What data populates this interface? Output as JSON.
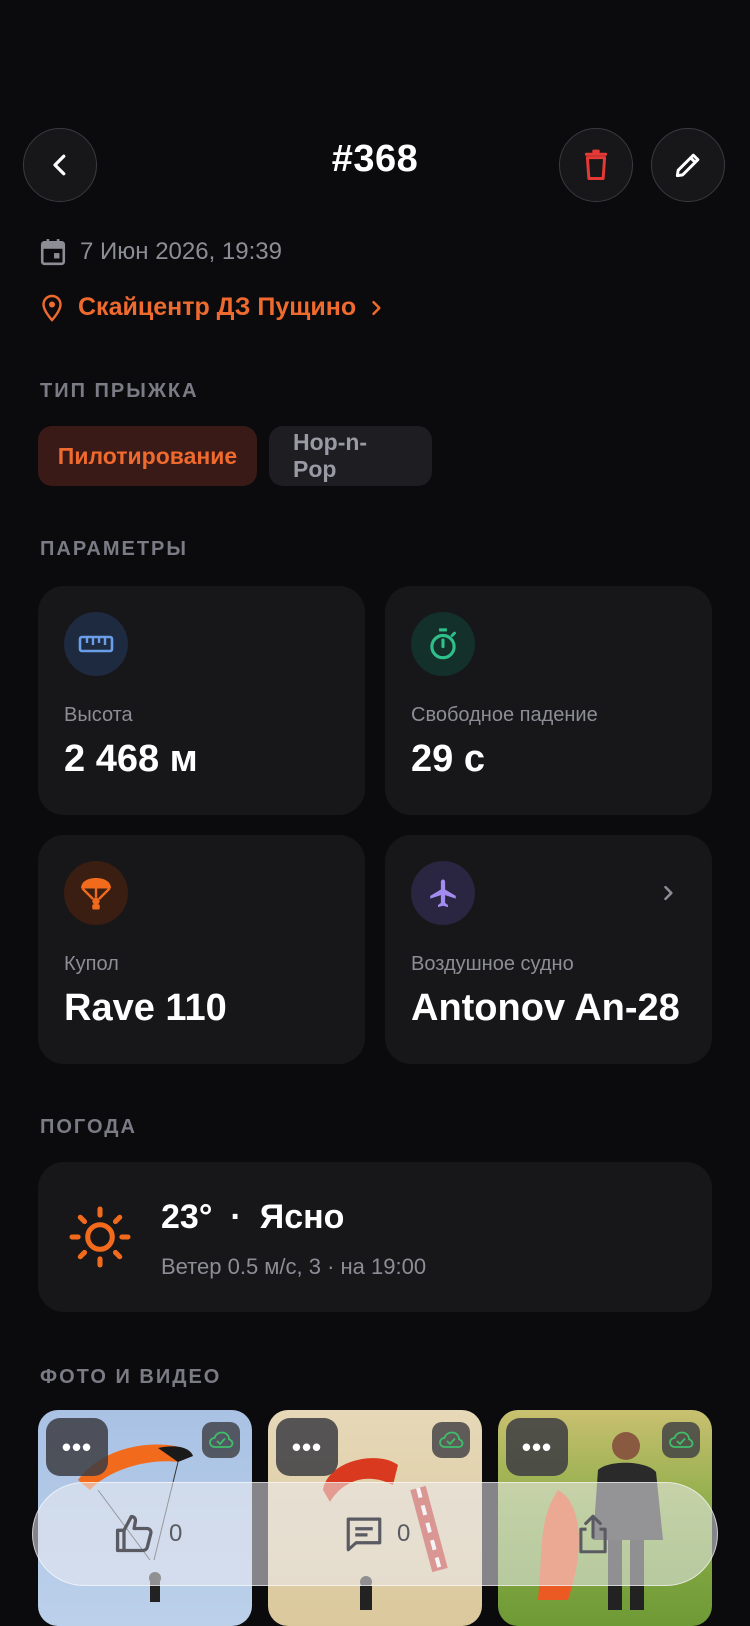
{
  "header": {
    "title": "#368"
  },
  "meta": {
    "date": "7 Июн 2026, 19:39",
    "location": "Скайцентр ДЗ Пущино"
  },
  "jump_type": {
    "label": "ТИП ПРЫЖКА",
    "chips": [
      {
        "label": "Пилотирование",
        "selected": true
      },
      {
        "label": "Hop-n-Pop",
        "selected": false
      }
    ]
  },
  "params": {
    "label": "ПАРАМЕТРЫ",
    "altitude": {
      "label": "Высота",
      "value": "2 468 м",
      "icon": "ruler-icon"
    },
    "freefall": {
      "label": "Свободное падение",
      "value": "29 с",
      "icon": "stopwatch-icon"
    },
    "canopy": {
      "label": "Купол",
      "value": "Rave 110",
      "icon": "parachute-icon"
    },
    "aircraft": {
      "label": "Воздушное судно",
      "value": "Antonov An-28",
      "icon": "airplane-icon"
    }
  },
  "weather": {
    "label": "ПОГОДА",
    "temp": "23°",
    "separator": "·",
    "condition": "Ясно",
    "details": "Ветер 0.5 м/с, 3 · на 19:00"
  },
  "media": {
    "label": "ФОТО И ВИДЕО",
    "more_label": "•••"
  },
  "actions": {
    "likes": "0",
    "comments": "0"
  },
  "colors": {
    "accent": "#ef6a2e",
    "delete": "#e53935",
    "background": "#0b0b0d",
    "card": "#17171a",
    "weather_sun": "#f26b1d"
  }
}
